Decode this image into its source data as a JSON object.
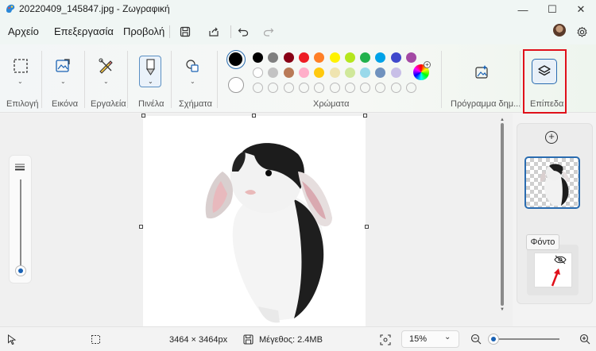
{
  "window": {
    "title": "20220409_145847.jpg - Ζωγραφική",
    "minimize_glyph": "—",
    "maximize_glyph": "☐",
    "close_glyph": "✕"
  },
  "menu": {
    "file": "Αρχείο",
    "edit": "Επεξεργασία",
    "view": "Προβολή"
  },
  "ribbon": {
    "groups": {
      "selection": "Επιλογή",
      "image": "Εικόνα",
      "tools": "Εργαλεία",
      "brushes": "Πινέλα",
      "shapes": "Σχήματα",
      "colors": "Χρώματα",
      "creator": "Πρόγραμμα δημ...",
      "layers": "Επίπεδα"
    },
    "primary_color": "#000000",
    "secondary_color": "#ffffff",
    "palette_row1": [
      "#000000",
      "#7f7f7f",
      "#880015",
      "#ed1c24",
      "#ff7f27",
      "#fff200",
      "#b5e61d",
      "#22b14c",
      "#00a2e8",
      "#3f48cc",
      "#a349a4"
    ],
    "palette_row2": [
      "#ffffff",
      "#c3c3c3",
      "#b97a57",
      "#ffaec9",
      "#ffc90e",
      "#efe4b0",
      "#d0e89a",
      "#99d9ea",
      "#7092be",
      "#c8bfe7"
    ],
    "palette_row3_empty_count": 11
  },
  "canvas": {
    "subject": "rabbit-cutout"
  },
  "layers_panel": {
    "add_glyph": "+",
    "tooltip": "Φόντο"
  },
  "status": {
    "dimensions": "3464 × 3464px",
    "size": "Μέγεθος: 2.4MB",
    "zoom": "15%",
    "zoom_level": 0.05
  }
}
